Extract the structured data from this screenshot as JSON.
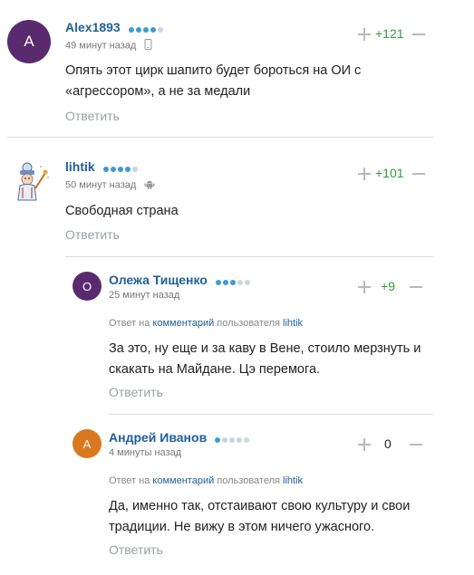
{
  "comments": [
    {
      "avatar_letter": "А",
      "avatar_color": "#5a2a6e",
      "username": "Alex1893",
      "rating_dots": 4,
      "time": "49 минут назад",
      "device": "mobile",
      "score": "+121",
      "text": "Опять этот цирк шапито будет бороться на ОИ с «агрессором», а не за медали",
      "reply_label": "Ответить"
    },
    {
      "avatar_letter": "",
      "avatar_color": "#ffffff",
      "username": "lihtik",
      "rating_dots": 4,
      "time": "50 минут назад",
      "device": "android",
      "score": "+101",
      "text": "Свободная страна",
      "reply_label": "Ответить"
    },
    {
      "avatar_letter": "О",
      "avatar_color": "#5a2a6e",
      "username": "Олежа Тищенко",
      "rating_dots": 3,
      "time": "25 минут назад",
      "reply_prefix": "Ответ на",
      "reply_link": "комментарий",
      "reply_middle": "пользователя",
      "reply_user": "lihtik",
      "score": "+9",
      "text": "За это, ну еще и за каву в Вене, стоило мерзнуть и скакать на Майдане. Цэ перемога.",
      "reply_label": "Ответить"
    },
    {
      "avatar_letter": "А",
      "avatar_color": "#d9791f",
      "username": "Андрей Иванов",
      "rating_dots": 1,
      "time": "4 минуты назад",
      "reply_prefix": "Ответ на",
      "reply_link": "комментарий",
      "reply_middle": "пользователя",
      "reply_user": "lihtik",
      "score": "0",
      "text": "Да, именно так, отстаивают свою культуру и свои традиции. Не вижу в этом ничего ужасного.",
      "reply_label": "Ответить"
    }
  ]
}
